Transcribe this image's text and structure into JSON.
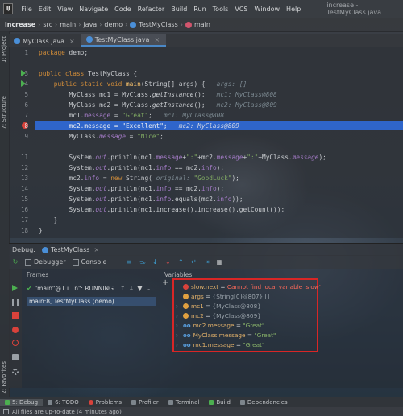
{
  "menubar": {
    "logo": "IJ",
    "items": [
      "File",
      "Edit",
      "View",
      "Navigate",
      "Code",
      "Refactor",
      "Build",
      "Run",
      "Tools",
      "VCS",
      "Window",
      "Help"
    ],
    "title": "increase - TestMyClass.java"
  },
  "breadcrumb": [
    "increase",
    "src",
    "main",
    "java",
    "demo",
    "TestMyClass",
    "main"
  ],
  "side_tabs": {
    "project": "1: Project",
    "structure": "7: Structure",
    "favorites": "2: Favorites"
  },
  "tabs": [
    {
      "label": "MyClass.java",
      "active": false
    },
    {
      "label": "TestMyClass.java",
      "active": true
    }
  ],
  "code": {
    "lines": [
      {
        "n": "1",
        "text": "package demo;"
      },
      {
        "n": "2",
        "text": ""
      },
      {
        "n": "3",
        "text": "public class TestMyClass {"
      },
      {
        "n": "4",
        "text": "    public static void main(String[] args) {   args: []"
      },
      {
        "n": "5",
        "text": "        MyClass mc1 = MyClass.getInstance();   mc1: MyClass@808"
      },
      {
        "n": "6",
        "text": "        MyClass mc2 = MyClass.getInstance();   mc2: MyClass@809"
      },
      {
        "n": "7",
        "text": "        mc1.message = \"Great\";   mc1: MyClass@808"
      },
      {
        "n": "8",
        "text": "        mc2.message = \"Excellent\";   mc2: MyClass@809"
      },
      {
        "n": "9",
        "text": "        MyClass.message = \"Nice\";"
      },
      {
        "n": "10",
        "text": ""
      },
      {
        "n": "11",
        "text": "        System.out.println(mc1.message+\":\"+mc2.message+\":\"+MyClass.message);"
      },
      {
        "n": "12",
        "text": "        System.out.println(mc1.info == mc2.info);"
      },
      {
        "n": "13",
        "text": "        mc2.info = new String( original: \"GoodLuck\");"
      },
      {
        "n": "14",
        "text": "        System.out.println(mc1.info == mc2.info);"
      },
      {
        "n": "15",
        "text": "        System.out.println(mc1.info.equals(mc2.info));"
      },
      {
        "n": "16",
        "text": "        System.out.println(mc1.increase().increase().getCount());"
      },
      {
        "n": "17",
        "text": "    }"
      },
      {
        "n": "18",
        "text": "}"
      }
    ]
  },
  "debug": {
    "label": "Debug:",
    "config": "TestMyClass",
    "debugger_tab": "Debugger",
    "console_tab": "Console",
    "frames_title": "Frames",
    "variables_title": "Variables",
    "thread": "\"main\"@1 i...n\": RUNNING",
    "frame": "main:8, TestMyClass (demo)",
    "variables": [
      {
        "name": "slow.next",
        "value": "Cannot find local variable 'slow'",
        "kind": "error"
      },
      {
        "name": "args",
        "value": "{String[0]@807} []",
        "kind": "param"
      },
      {
        "name": "mc1",
        "value": "{MyClass@808}",
        "kind": "local"
      },
      {
        "name": "mc2",
        "value": "{MyClass@809}",
        "kind": "local"
      },
      {
        "name": "mc2.message",
        "value": "\"Great\"",
        "kind": "watch"
      },
      {
        "name": "MyClass.message",
        "value": "\"Great\"",
        "kind": "watch"
      },
      {
        "name": "mc1.message",
        "value": "\"Great\"",
        "kind": "watch"
      }
    ]
  },
  "bottom_tabs": [
    "5: Debug",
    "6: TODO",
    "Problems",
    "Profiler",
    "Terminal",
    "Build",
    "Dependencies"
  ],
  "status": "All files are up-to-date (4 minutes ago)",
  "colors": {
    "accent": "#2f65ca",
    "error_border": "#d82626",
    "run_green": "#4caf50",
    "breakpoint": "#d9423b"
  }
}
